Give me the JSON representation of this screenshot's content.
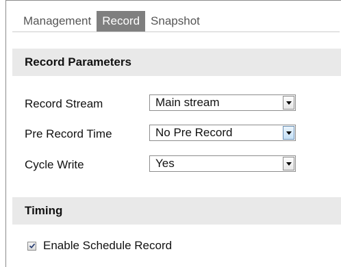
{
  "tabs": [
    {
      "label": "Management",
      "active": false
    },
    {
      "label": "Record",
      "active": true
    },
    {
      "label": "Snapshot",
      "active": false
    }
  ],
  "record_parameters": {
    "title": "Record Parameters",
    "rows": [
      {
        "label": "Record Stream",
        "value": "Main stream"
      },
      {
        "label": "Pre Record Time",
        "value": "No Pre Record"
      },
      {
        "label": "Cycle Write",
        "value": "Yes"
      }
    ]
  },
  "timing": {
    "title": "Timing",
    "enable_schedule": {
      "label": "Enable Schedule Record",
      "checked": true
    }
  },
  "icons": {
    "dropdown": "chevron-down-icon",
    "check": "checkmark-icon"
  },
  "colors": {
    "active_tab": "#7f7f7f",
    "section_header_bg": "#e9e9e9"
  }
}
